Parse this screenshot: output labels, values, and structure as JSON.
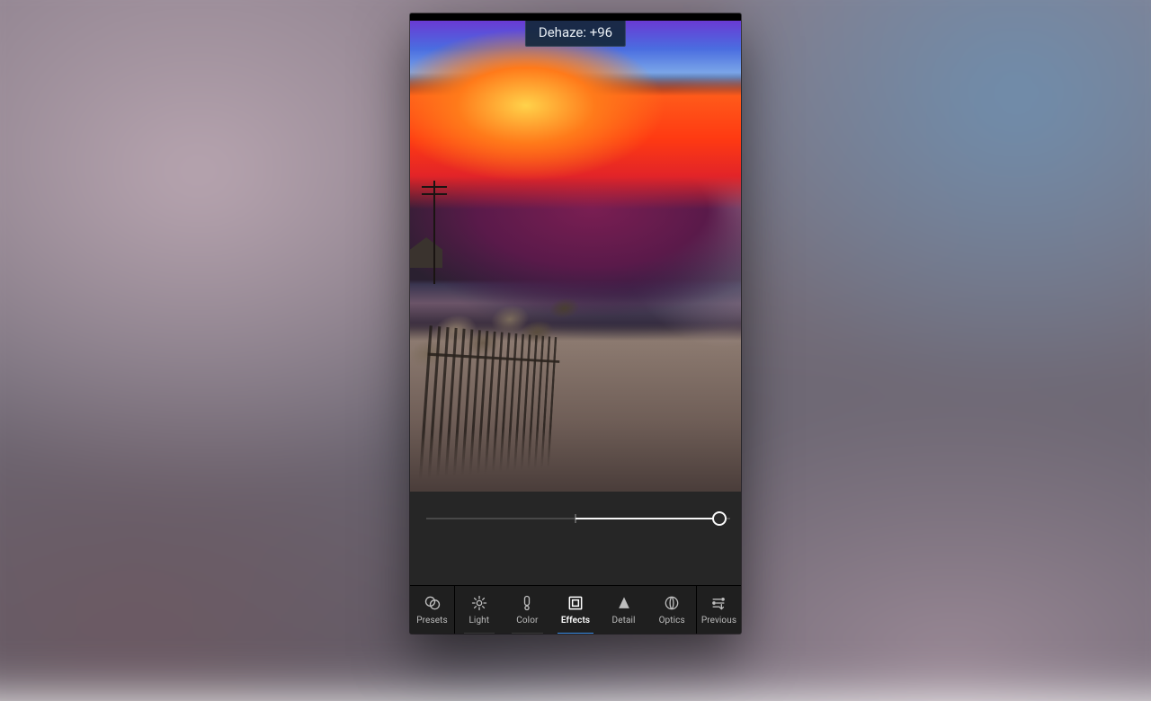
{
  "adjustment": {
    "label": "Dehaze",
    "value": 96,
    "display": "Dehaze: +96",
    "min": -100,
    "max": 100
  },
  "toolbar": {
    "items": [
      {
        "id": "presets",
        "label": "Presets"
      },
      {
        "id": "light",
        "label": "Light"
      },
      {
        "id": "color",
        "label": "Color"
      },
      {
        "id": "effects",
        "label": "Effects"
      },
      {
        "id": "detail",
        "label": "Detail"
      },
      {
        "id": "optics",
        "label": "Optics"
      },
      {
        "id": "previous",
        "label": "Previous"
      }
    ],
    "active": "effects"
  }
}
